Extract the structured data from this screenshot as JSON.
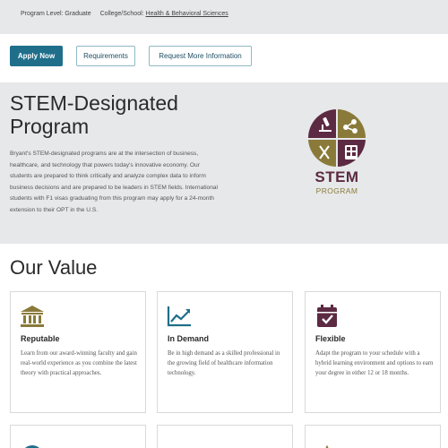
{
  "program_meta": {
    "level": "Program Level: Graduate",
    "college_label": "College/School:",
    "college_link": "Health & Behavioral Sciences"
  },
  "actions": {
    "apply": "Apply Now",
    "requirements": "Requirements",
    "request_info": "Request More Information"
  },
  "stem_section": {
    "title": "STEM-Designated Program",
    "body": "Bryant's STEM-designated programs are at the intersection of business, healthcare, and technology that powers today's innovative economy. Our students are prepared to think critically and analyze complex data to inform business decisions and are prepared to be leaders in STEM fields. International students with F1 visas graduating from this program may apply for a 24-month extension to their OPT in the U.S.",
    "logo_word": "STEM",
    "logo_sub": "PROGRAM",
    "logo_colors": {
      "plum": "#5c2a42",
      "gold": "#8a7a3a"
    }
  },
  "our_value": {
    "title": "Our Value",
    "cards": [
      {
        "icon": "institution-icon",
        "title": "Reputable",
        "text": "Learn from our award-winning faculty and gain real-world experience as you combine the latest theory with practical approaches."
      },
      {
        "icon": "trend-chart-icon",
        "title": "In Demand",
        "text": "Be in high demand as a skilled professional in the growing field of healthcare information technology."
      },
      {
        "icon": "calendar-check-icon",
        "title": "Flexible",
        "text": "Adapt the program to your schedule with a hybrid learning environment and options to earn your degree in either 12 or 18 months."
      }
    ]
  },
  "colors": {
    "accent": "#1f6f8b",
    "plum": "#5c2a42",
    "gold": "#8a7a3a",
    "section_bg": "#e6e8e9"
  }
}
